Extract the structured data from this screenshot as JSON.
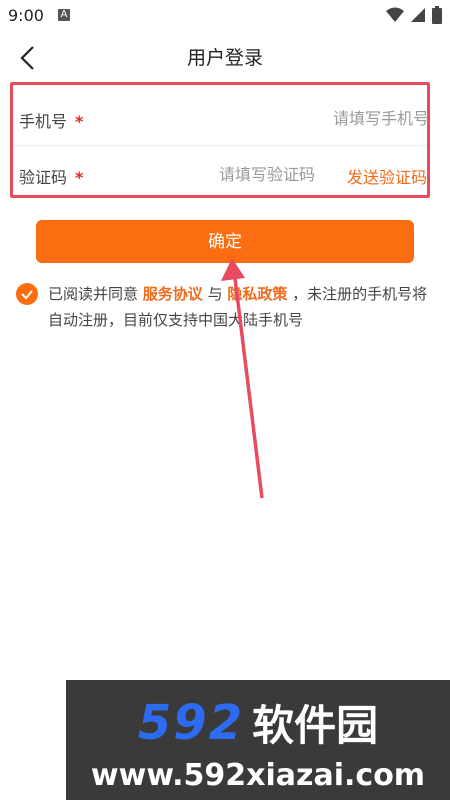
{
  "status_bar": {
    "time": "9:00",
    "notif_letter": "A"
  },
  "header": {
    "title": "用户登录"
  },
  "form": {
    "phone": {
      "label": "手机号",
      "required_mark": "*",
      "placeholder": "请填写手机号"
    },
    "code": {
      "label": "验证码",
      "required_mark": "*",
      "placeholder": "请填写验证码",
      "send_label": "发送验证码"
    }
  },
  "confirm_label": "确定",
  "agreement": {
    "checked": true,
    "text_before": "已阅读并同意 ",
    "terms_link": "服务协议",
    "middle": " 与 ",
    "privacy_link": "隐私政策",
    "text_after": " ，未注册的手机号将自动注册，目前仅支持中国大陆手机号"
  },
  "colors": {
    "accent": "#fb6d10",
    "link": "#f26b1d",
    "highlight_box": "#e84a5f",
    "required": "#e1251b"
  },
  "watermark": {
    "brand_num": "592",
    "brand_cn": "软件园",
    "url": "www.592xiazai.com"
  }
}
